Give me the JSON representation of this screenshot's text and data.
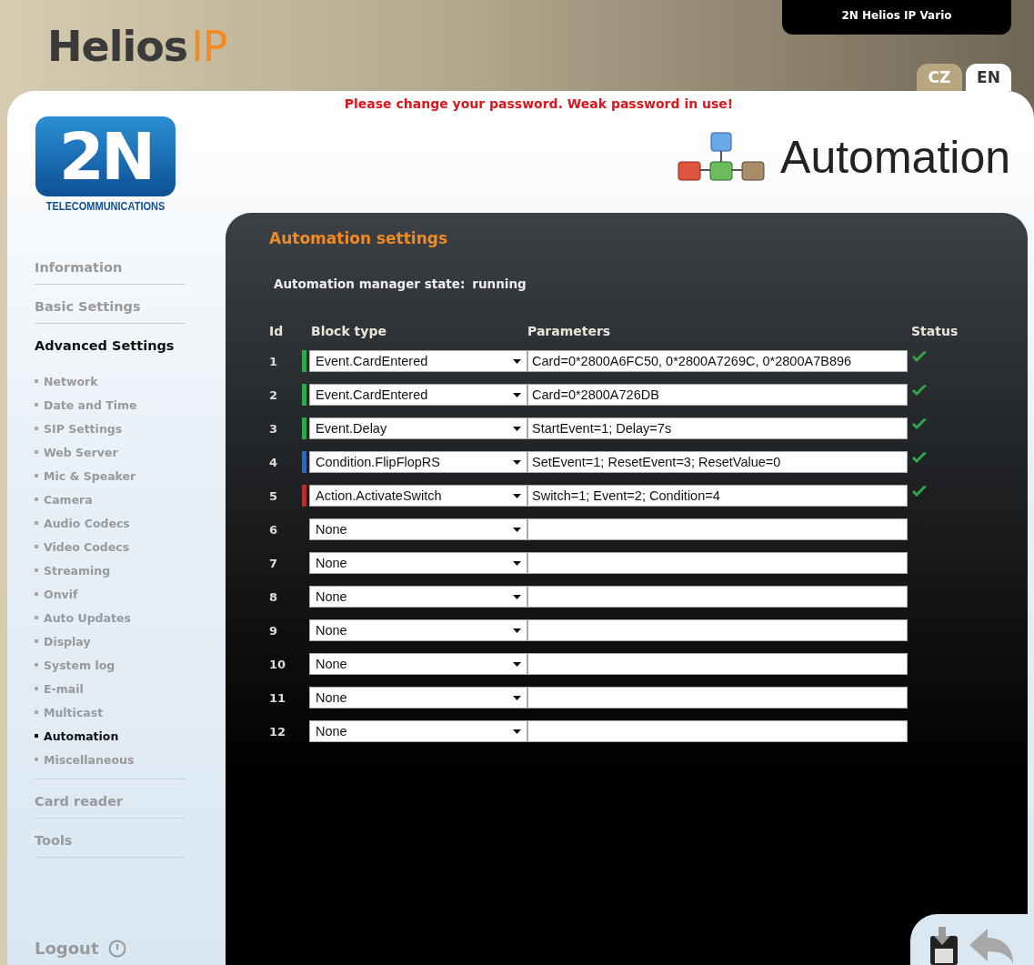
{
  "header": {
    "logo": {
      "word": "Helios",
      "suffix": "IP"
    },
    "device_name": "2N Helios IP Vario",
    "languages": [
      {
        "label": "CZ",
        "selected": false
      },
      {
        "label": "EN",
        "selected": true
      }
    ]
  },
  "warning": "Please change your password. Weak password in use!",
  "brand": {
    "mark": "2N",
    "tagline": "TELECOMMUNICATIONS"
  },
  "page_title": "Automation",
  "sidebar": {
    "items": [
      {
        "label": "Information",
        "selected": false
      },
      {
        "label": "Basic Settings",
        "selected": false
      },
      {
        "label": "Advanced Settings",
        "selected": true,
        "children": [
          {
            "label": "Network",
            "selected": false
          },
          {
            "label": "Date and Time",
            "selected": false
          },
          {
            "label": "SIP Settings",
            "selected": false
          },
          {
            "label": "Web Server",
            "selected": false
          },
          {
            "label": "Mic & Speaker",
            "selected": false
          },
          {
            "label": "Camera",
            "selected": false
          },
          {
            "label": "Audio Codecs",
            "selected": false
          },
          {
            "label": "Video Codecs",
            "selected": false
          },
          {
            "label": "Streaming",
            "selected": false
          },
          {
            "label": "Onvif",
            "selected": false
          },
          {
            "label": "Auto Updates",
            "selected": false
          },
          {
            "label": "Display",
            "selected": false
          },
          {
            "label": "System log",
            "selected": false
          },
          {
            "label": "E-mail",
            "selected": false
          },
          {
            "label": "Multicast",
            "selected": false
          },
          {
            "label": "Automation",
            "selected": true
          },
          {
            "label": "Miscellaneous",
            "selected": false
          }
        ]
      },
      {
        "label": "Card reader",
        "selected": false
      },
      {
        "label": "Tools",
        "selected": false
      }
    ],
    "logout": "Logout"
  },
  "panel": {
    "title": "Automation settings",
    "state_label": "Automation manager state:",
    "state_value": "running",
    "columns": [
      "Id",
      "Block type",
      "Parameters",
      "Status"
    ],
    "rows": [
      {
        "id": "1",
        "block_type": "Event.CardEntered",
        "parameters": "Card=0*2800A6FC50, 0*2800A7269C, 0*2800A7B896",
        "color": "#2fa84a",
        "ok": true
      },
      {
        "id": "2",
        "block_type": "Event.CardEntered",
        "parameters": "Card=0*2800A726DB",
        "color": "#2fa84a",
        "ok": true
      },
      {
        "id": "3",
        "block_type": "Event.Delay",
        "parameters": "StartEvent=1; Delay=7s",
        "color": "#2fa84a",
        "ok": true
      },
      {
        "id": "4",
        "block_type": "Condition.FlipFlopRS",
        "parameters": "SetEvent=1; ResetEvent=3; ResetValue=0",
        "color": "#3466b8",
        "ok": true
      },
      {
        "id": "5",
        "block_type": "Action.ActivateSwitch",
        "parameters": "Switch=1; Event=2; Condition=4",
        "color": "#b23030",
        "ok": true
      },
      {
        "id": "6",
        "block_type": "None",
        "ok": false
      },
      {
        "id": "7",
        "block_type": "None",
        "ok": false
      },
      {
        "id": "8",
        "block_type": "None",
        "ok": false
      },
      {
        "id": "9",
        "block_type": "None",
        "ok": false
      },
      {
        "id": "10",
        "block_type": "None",
        "ok": false
      },
      {
        "id": "11",
        "block_type": "None",
        "ok": false
      },
      {
        "id": "12",
        "block_type": "None",
        "ok": false
      }
    ]
  }
}
